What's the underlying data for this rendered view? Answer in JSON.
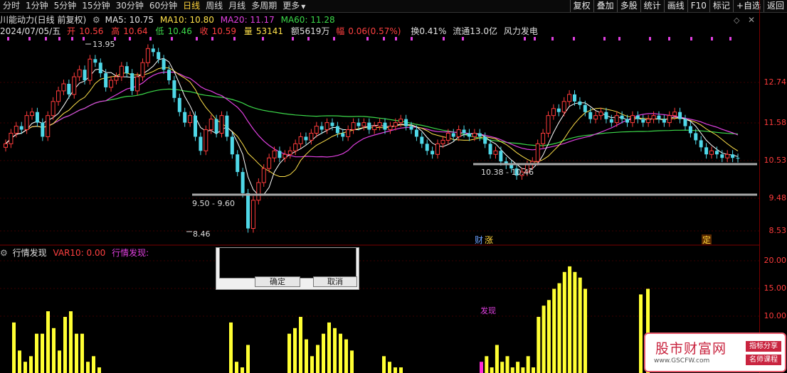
{
  "toolbar": {
    "periods": [
      "分时",
      "1分钟",
      "5分钟",
      "15分钟",
      "30分钟",
      "60分钟",
      "日线",
      "周线",
      "月线",
      "多周期",
      "更多"
    ],
    "active_index": 6,
    "right_buttons": [
      "复权",
      "叠加",
      "多股",
      "统计",
      "画线",
      "F10",
      "标记",
      "+自选",
      "返回"
    ]
  },
  "info": {
    "stock_title": "川能动力(日线 前复权)",
    "ma5": "MA5: 10.75",
    "ma10": "MA10: 10.80",
    "ma20": "MA20: 11.17",
    "ma60": "MA60: 11.28",
    "date": "2024/07/05/五",
    "open_label": "开",
    "open": "10.56",
    "high_label": "高",
    "high": "10.64",
    "low_label": "低",
    "low": "10.46",
    "close_label": "收",
    "close": "10.59",
    "vol_label": "量",
    "vol": "53141",
    "amount": "额5619万",
    "amp_label": "幅",
    "amp": "0.06(0.57%)",
    "turnover": "换0.41%",
    "float": "流通13.0亿",
    "sector": "风力发电"
  },
  "annotations": {
    "peak": "13.95",
    "support1": "9.50 - 9.60",
    "bottom": "8.46",
    "support2": "10.38 - 10.46",
    "event1": "财",
    "event1b": "涨",
    "event2": "定",
    "signal": "发现"
  },
  "yaxis_price": [
    "12.74",
    "11.58",
    "10.53",
    "9.48",
    "8.53"
  ],
  "yaxis_vol": [
    "20.00",
    "15.00",
    "10.00"
  ],
  "lower": {
    "title": "行情发现",
    "var": "VAR10: 0.00",
    "name": "行情发现:"
  },
  "dialog": {
    "ok": "确定",
    "cancel": "取消"
  },
  "logo": {
    "main": "股市财富网",
    "url": "www.GSCFW.com",
    "tag1": "指标分享",
    "tag2": "名师课程"
  },
  "chart_data": {
    "type": "candlestick",
    "closes": [
      11.0,
      11.3,
      11.5,
      11.4,
      11.8,
      11.9,
      11.6,
      11.2,
      11.8,
      12.2,
      12.5,
      12.7,
      12.4,
      12.9,
      13.1,
      12.8,
      13.4,
      13.3,
      13.0,
      12.6,
      12.8,
      12.9,
      13.2,
      13.0,
      12.5,
      12.9,
      13.3,
      13.7,
      13.6,
      13.4,
      13.1,
      12.8,
      12.3,
      11.9,
      11.6,
      11.8,
      11.2,
      10.8,
      11.4,
      11.7,
      11.3,
      11.8,
      11.2,
      10.7,
      10.2,
      9.6,
      8.6,
      9.4,
      9.9,
      10.3,
      10.6,
      10.8,
      10.6,
      10.7,
      10.8,
      11.0,
      11.2,
      11.1,
      11.3,
      11.5,
      11.4,
      11.6,
      11.5,
      11.3,
      11.2,
      11.4,
      11.6,
      11.5,
      11.6,
      11.4,
      11.5,
      11.6,
      11.4,
      11.5,
      11.6,
      11.7,
      11.5,
      11.4,
      11.2,
      11.0,
      10.8,
      10.7,
      11.0,
      11.1,
      11.3,
      11.2,
      11.4,
      11.3,
      11.2,
      11.3,
      11.2,
      11.0,
      10.7,
      10.8,
      10.5,
      10.4,
      10.3,
      10.1,
      10.2,
      10.4,
      10.5,
      11.0,
      11.3,
      11.8,
      12.0,
      11.9,
      12.2,
      12.4,
      12.2,
      12.1,
      11.9,
      11.7,
      11.8,
      11.9,
      11.7,
      11.6,
      11.8,
      11.7,
      11.6,
      11.8,
      11.7,
      11.6,
      11.7,
      11.8,
      11.7,
      11.6,
      11.8,
      11.9,
      11.7,
      11.5,
      11.3,
      11.1,
      10.9,
      10.7,
      10.8,
      10.7,
      10.6,
      10.7,
      10.6,
      10.59
    ],
    "ma60_note": "MA60",
    "volume": [
      9,
      4,
      2,
      3,
      7,
      7,
      11,
      8,
      4,
      10,
      11,
      7,
      7,
      2,
      3,
      1,
      9,
      2,
      1,
      5,
      7,
      8,
      10,
      6,
      3,
      5,
      7,
      9,
      8,
      7,
      6,
      4,
      3,
      2,
      1,
      1,
      2,
      3,
      1,
      5,
      2,
      3,
      1,
      2,
      1,
      3,
      1,
      10,
      12,
      13,
      15,
      16,
      18,
      19,
      18,
      17,
      15,
      14,
      15,
      16,
      14,
      13,
      12,
      12,
      13,
      16,
      2
    ]
  }
}
